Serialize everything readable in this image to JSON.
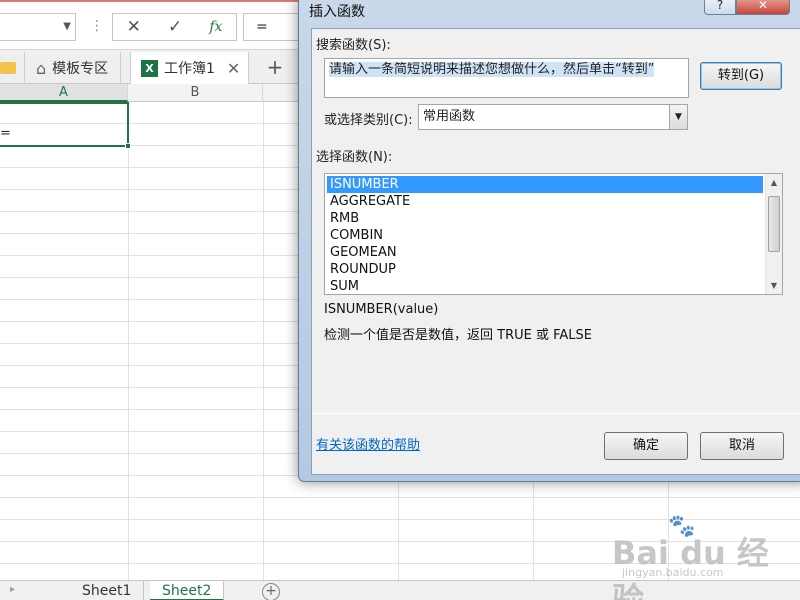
{
  "excel": {
    "namebox_value": "",
    "formula_value": "=",
    "icons": {
      "cancel": "✕",
      "enter": "✓",
      "fx": "fx"
    },
    "tabs": [
      {
        "label": "模板专区"
      },
      {
        "label": "工作簿1"
      }
    ],
    "columns": [
      "A",
      "B"
    ],
    "cell_a1_value": "=",
    "sheets": [
      "Sheet1",
      "Sheet2"
    ],
    "active_sheet": "Sheet2"
  },
  "dialog": {
    "title": "插入函数",
    "help_button": "?",
    "search_label": "搜索函数(S):",
    "search_value": "请输入一条简短说明来描述您想做什么，然后单击“转到”",
    "go_button": "转到(G)",
    "category_label": "或选择类别(C):",
    "category_value": "常用函数",
    "select_label": "选择函数(N):",
    "functions": [
      "ISNUMBER",
      "AGGREGATE",
      "RMB",
      "COMBIN",
      "GEOMEAN",
      "ROUNDUP",
      "SUM"
    ],
    "selected_function": "ISNUMBER",
    "signature": "ISNUMBER(value)",
    "description": "检测一个值是否是数值，返回 TRUE 或 FALSE",
    "help_link": "有关该函数的帮助",
    "ok_button": "确定",
    "cancel_button": "取消"
  },
  "watermark": {
    "brand": "Bai du 经验",
    "url": "jingyan.baidu.com"
  },
  "colors": {
    "excel_green": "#217346",
    "selection_blue": "#3399ff",
    "link_blue": "#0066cc"
  }
}
